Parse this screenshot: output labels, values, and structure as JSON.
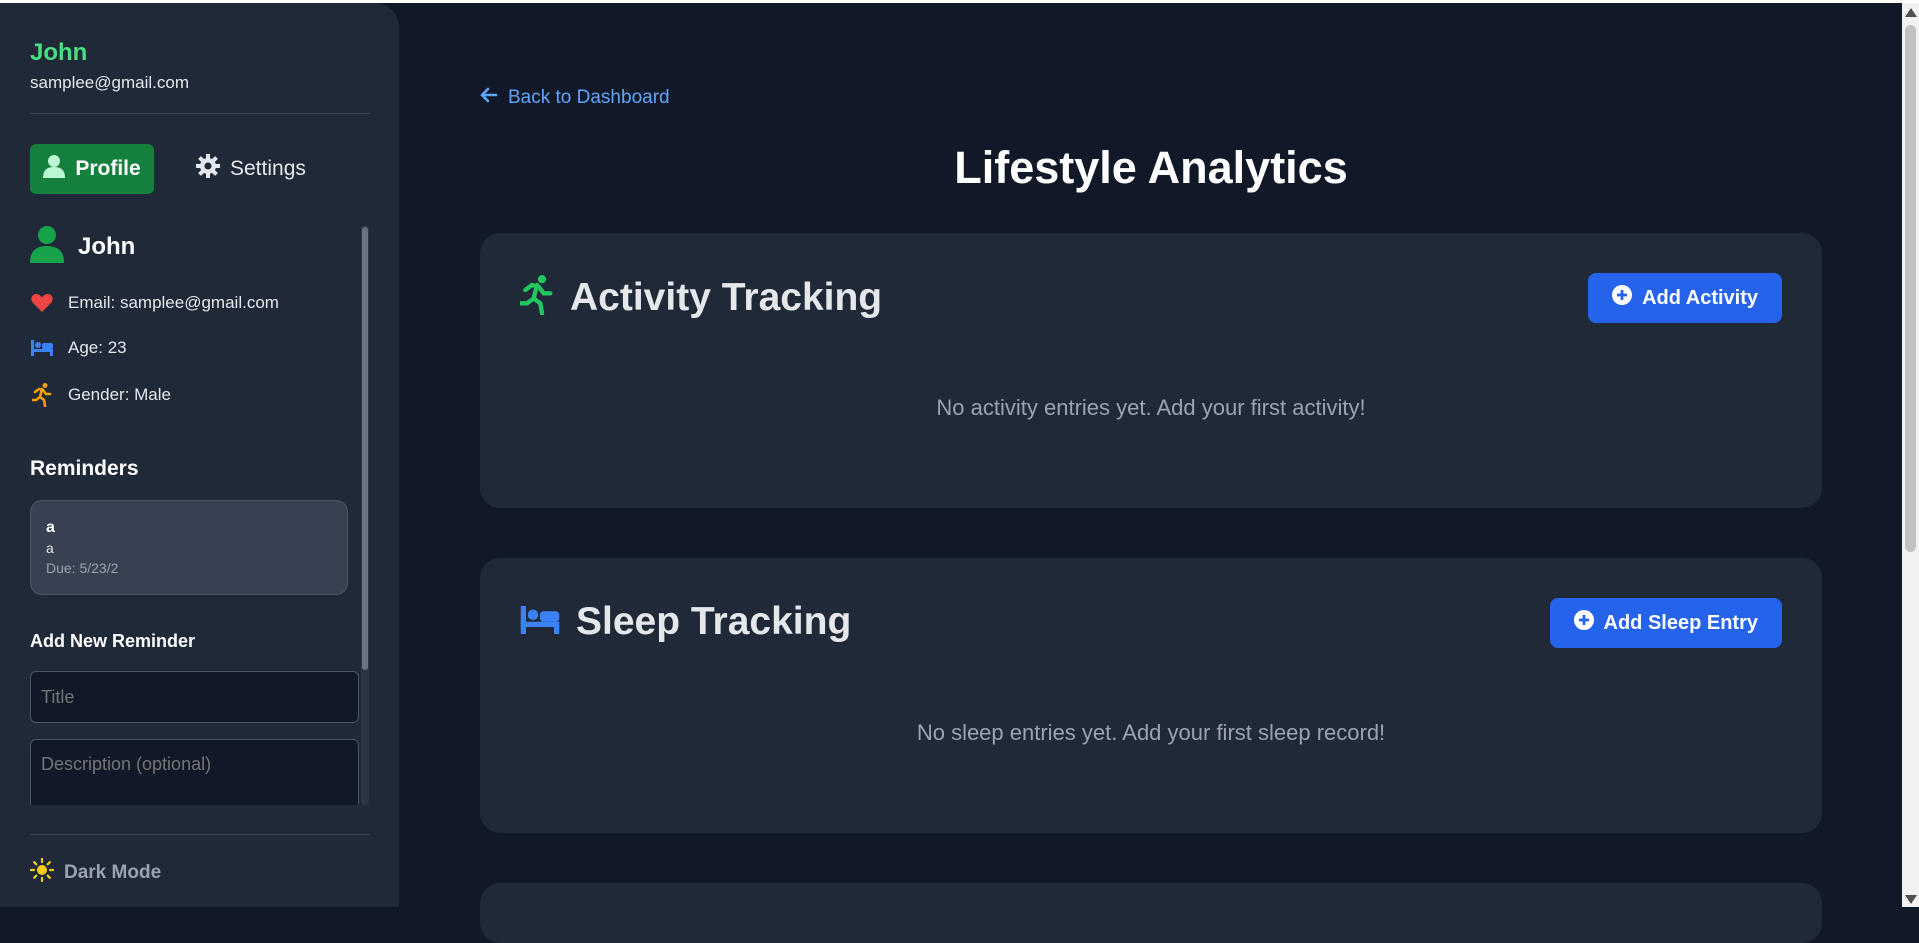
{
  "sidebar": {
    "user_name": "John",
    "user_email": "samplee@gmail.com",
    "tabs": {
      "profile": "Profile",
      "settings": "Settings"
    },
    "profile": {
      "name": "John",
      "email": "Email: samplee@gmail.com",
      "age": "Age: 23",
      "gender": "Gender: Male"
    },
    "reminders_title": "Reminders",
    "reminders": [
      {
        "title": "a",
        "description": "a",
        "due": "Due: 5/23/2"
      }
    ],
    "add_new_title": "Add New Reminder",
    "title_placeholder": "Title",
    "description_placeholder": "Description (optional)",
    "dark_mode_label": "Dark Mode"
  },
  "main": {
    "back_label": "Back to Dashboard",
    "page_title": "Lifestyle Analytics",
    "sections": [
      {
        "title": "Activity Tracking",
        "button": "Add Activity",
        "empty": "No activity entries yet. Add your first activity!"
      },
      {
        "title": "Sleep Tracking",
        "button": "Add Sleep Entry",
        "empty": "No sleep entries yet. Add your first sleep record!"
      }
    ]
  },
  "colors": {
    "background": "#111827",
    "panel": "#1f2937",
    "accent_green": "#4ade80",
    "accent_blue": "#2563eb",
    "link": "#60a5fa"
  }
}
